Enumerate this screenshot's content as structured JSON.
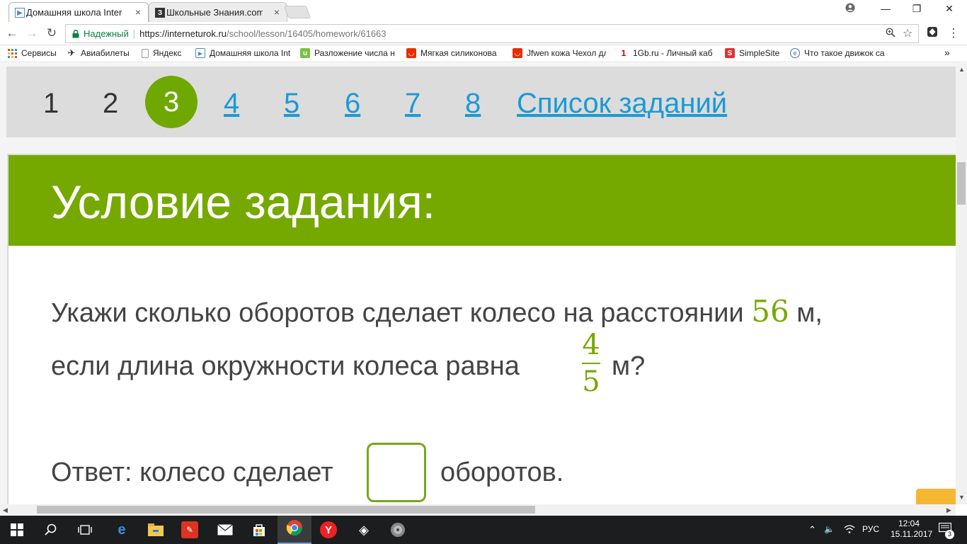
{
  "browser": {
    "tabs": [
      {
        "title": "Домашняя школа Intern",
        "close": "×"
      },
      {
        "title": "Школьные Знания.com",
        "close": "×"
      }
    ],
    "window_controls": {
      "minimize": "—",
      "maximize": "❐",
      "close": "✕"
    },
    "nav": {
      "back": "←",
      "forward": "→",
      "reload": "↻"
    },
    "omnibox": {
      "secure_label": "Надежный",
      "url_scheme_host": "https://interneturok.ru",
      "url_path": "/school/lesson/16405/homework/61663"
    },
    "bookmarks": [
      {
        "label": "Сервисы",
        "icon": "apps-grid-icon"
      },
      {
        "label": "Авиабилеты",
        "icon": "plane-icon"
      },
      {
        "label": "Яндекс",
        "icon": "page-icon"
      },
      {
        "label": "Домашняя школа Int",
        "icon": "play-icon"
      },
      {
        "label": "Разложение числа н",
        "icon": "u-icon"
      },
      {
        "label": "Мягкая силиконова",
        "icon": "aliexpress-icon"
      },
      {
        "label": "Jfwen кожа Чехол дл",
        "icon": "aliexpress-icon"
      },
      {
        "label": "1Gb.ru - Личный каб",
        "icon": "1gb-icon"
      },
      {
        "label": "SimpleSite",
        "icon": "simplesite-icon"
      },
      {
        "label": "Что такое движок са",
        "icon": "globe-icon"
      }
    ],
    "bookmarks_more": "»"
  },
  "task_nav": {
    "items": [
      {
        "label": "1",
        "state": "done"
      },
      {
        "label": "2",
        "state": "done"
      },
      {
        "label": "3",
        "state": "current"
      },
      {
        "label": "4",
        "state": "link"
      },
      {
        "label": "5",
        "state": "link"
      },
      {
        "label": "6",
        "state": "link"
      },
      {
        "label": "7",
        "state": "link"
      },
      {
        "label": "8",
        "state": "link"
      }
    ],
    "list_label": "Список заданий"
  },
  "task": {
    "header": "Условие задания:",
    "line1_before": "Укажи сколько оборотов сделает колесо на расстоянии ",
    "distance": "56",
    "line1_after": " м,",
    "line2_before": "если длина окружности колеса равна ",
    "fraction_numerator": "4",
    "fraction_denominator": "5",
    "line2_after": "м?",
    "answer_before": "Ответ: колесо сделает",
    "answer_value": "",
    "answer_after": "оборотов."
  },
  "side_tab_glyph": "‹",
  "taskbar": {
    "lang": "РУС",
    "time": "12:04",
    "date": "15.11.2017",
    "notifications": "3"
  },
  "colors": {
    "accent_green": "#76a900",
    "link_blue": "#1a9ad6",
    "side_tab_orange": "#f5b731"
  }
}
